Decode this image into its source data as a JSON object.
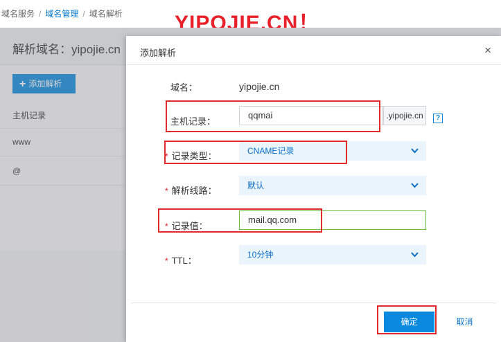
{
  "breadcrumb": {
    "items": [
      "域名服务",
      "域名管理",
      "域名解析"
    ],
    "separator": "/"
  },
  "watermark": "YIPOJIE.CN！",
  "page": {
    "title": "解析域名：yipojie.cn",
    "add_button": "添加解析",
    "list_header": "主机记录",
    "rows": [
      "www",
      "@"
    ]
  },
  "dialog": {
    "title": "添加解析",
    "close": "×",
    "domain_label": "域名：",
    "domain_value": "yipojie.cn",
    "host_label": "主机记录：",
    "host_value": "qqmai",
    "host_suffix": ".yipojie.cn",
    "help": "?",
    "required_mark": "*",
    "type_label": "记录类型：",
    "type_value": "CNAME记录",
    "line_label": "解析线路：",
    "line_value": "默认",
    "record_label": "记录值：",
    "record_value": "mail.qq.com",
    "ttl_label": "TTL：",
    "ttl_value": "10分钟",
    "confirm": "确定",
    "cancel": "取消"
  },
  "colors": {
    "accent": "#0a8adf",
    "annotation": "#e32a2a",
    "valid": "#6abf40"
  }
}
